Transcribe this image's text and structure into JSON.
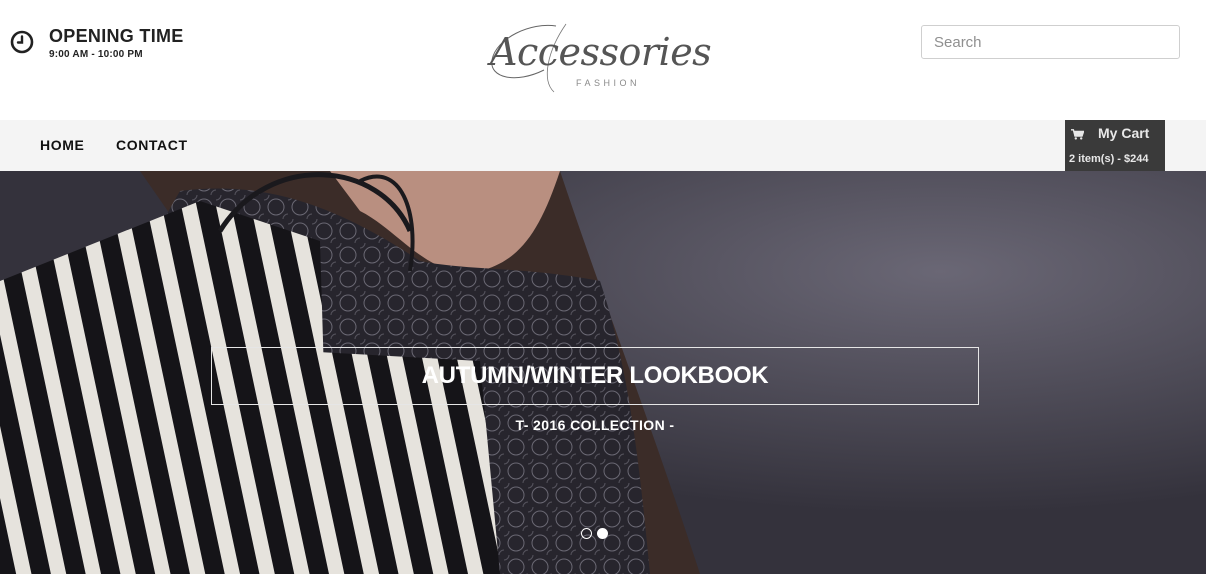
{
  "header": {
    "opening": {
      "title": "OPENING TIME",
      "hours": "9:00 AM - 10:00 PM",
      "icon": "clock-icon"
    },
    "logo": {
      "script": "Accessories",
      "subtitle": "FASHION"
    },
    "search": {
      "placeholder": "Search",
      "value": ""
    }
  },
  "nav": {
    "items": [
      {
        "label": "HOME"
      },
      {
        "label": "CONTACT"
      }
    ]
  },
  "cart": {
    "icon": "cart-icon",
    "title": "My Cart",
    "summary": "2 item(s) - $244"
  },
  "hero": {
    "title": "AUTUMN/WINTER LOOKBOOK",
    "subtitle": "T- 2016 COLLECTION -",
    "slides": {
      "count": 2,
      "active_index": 1
    }
  },
  "colors": {
    "nav_background": "#f4f4f4",
    "cart_background": "#3a3a3a",
    "hero_background": "#3a3842",
    "text_dark": "#222222"
  }
}
